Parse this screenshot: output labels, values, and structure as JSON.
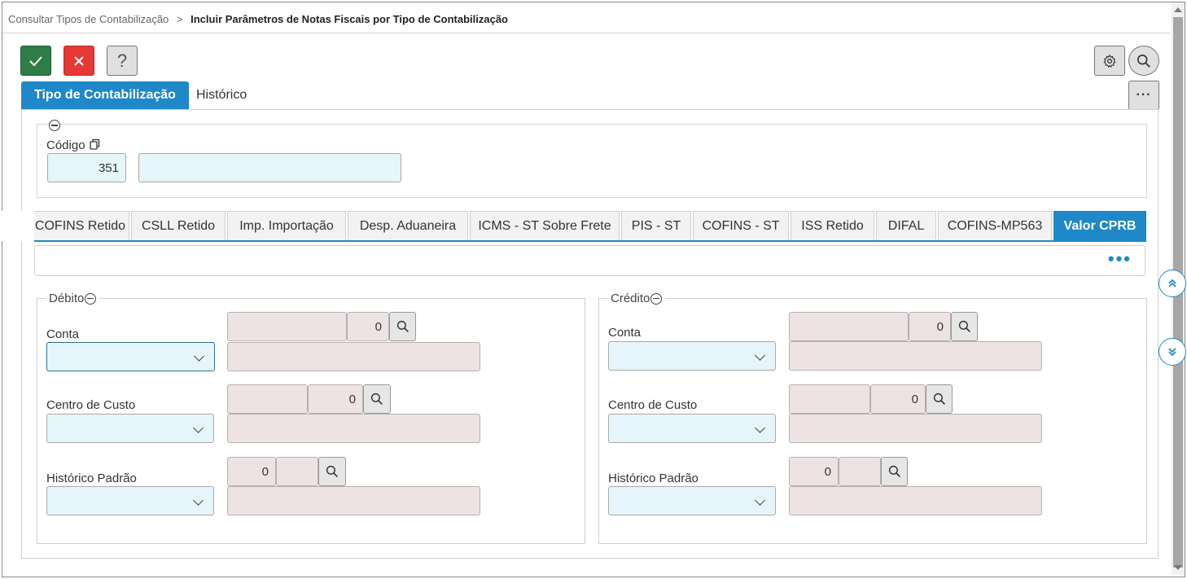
{
  "breadcrumb": {
    "parent": "Consultar Tipos de Contabilização",
    "separator": ">",
    "current": "Incluir Parâmetros de Notas Fiscais por Tipo de Contabilização"
  },
  "toolbar": {
    "confirm_icon": "check-icon",
    "cancel_icon": "close-icon",
    "help_label": "?",
    "settings_icon": "gear-icon",
    "search_icon": "search-icon",
    "more_label": "···"
  },
  "main_tabs": [
    {
      "label": "Tipo de Contabilização",
      "active": true
    },
    {
      "label": "Histórico",
      "active": false
    }
  ],
  "codigo": {
    "label": "Código",
    "value": "351",
    "description": ""
  },
  "sub_tabs": [
    {
      "label": "COFINS Retido",
      "active": false
    },
    {
      "label": "CSLL Retido",
      "active": false
    },
    {
      "label": "Imp. Importação",
      "active": false
    },
    {
      "label": "Desp. Aduaneira",
      "active": false
    },
    {
      "label": "ICMS - ST Sobre Frete",
      "active": false
    },
    {
      "label": "PIS - ST",
      "active": false
    },
    {
      "label": "COFINS - ST",
      "active": false
    },
    {
      "label": "ISS Retido",
      "active": false
    },
    {
      "label": "DIFAL",
      "active": false
    },
    {
      "label": "COFINS-MP563",
      "active": false
    },
    {
      "label": "Valor CPRB",
      "active": true
    }
  ],
  "subtab_more": "•••",
  "debito": {
    "legend": "Débito",
    "conta": {
      "label": "Conta",
      "code": "0"
    },
    "centro_custo": {
      "label": "Centro de Custo",
      "code": "0"
    },
    "historico": {
      "label": "Histórico Padrão",
      "code": "0"
    }
  },
  "credito": {
    "legend": "Crédito",
    "conta": {
      "label": "Conta",
      "code": "0"
    },
    "centro_custo": {
      "label": "Centro de Custo",
      "code": "0"
    },
    "historico": {
      "label": "Histórico Padrão",
      "code": "0"
    }
  },
  "colors": {
    "accent": "#1e88c8",
    "confirm": "#2e7d46",
    "cancel": "#e53935"
  }
}
